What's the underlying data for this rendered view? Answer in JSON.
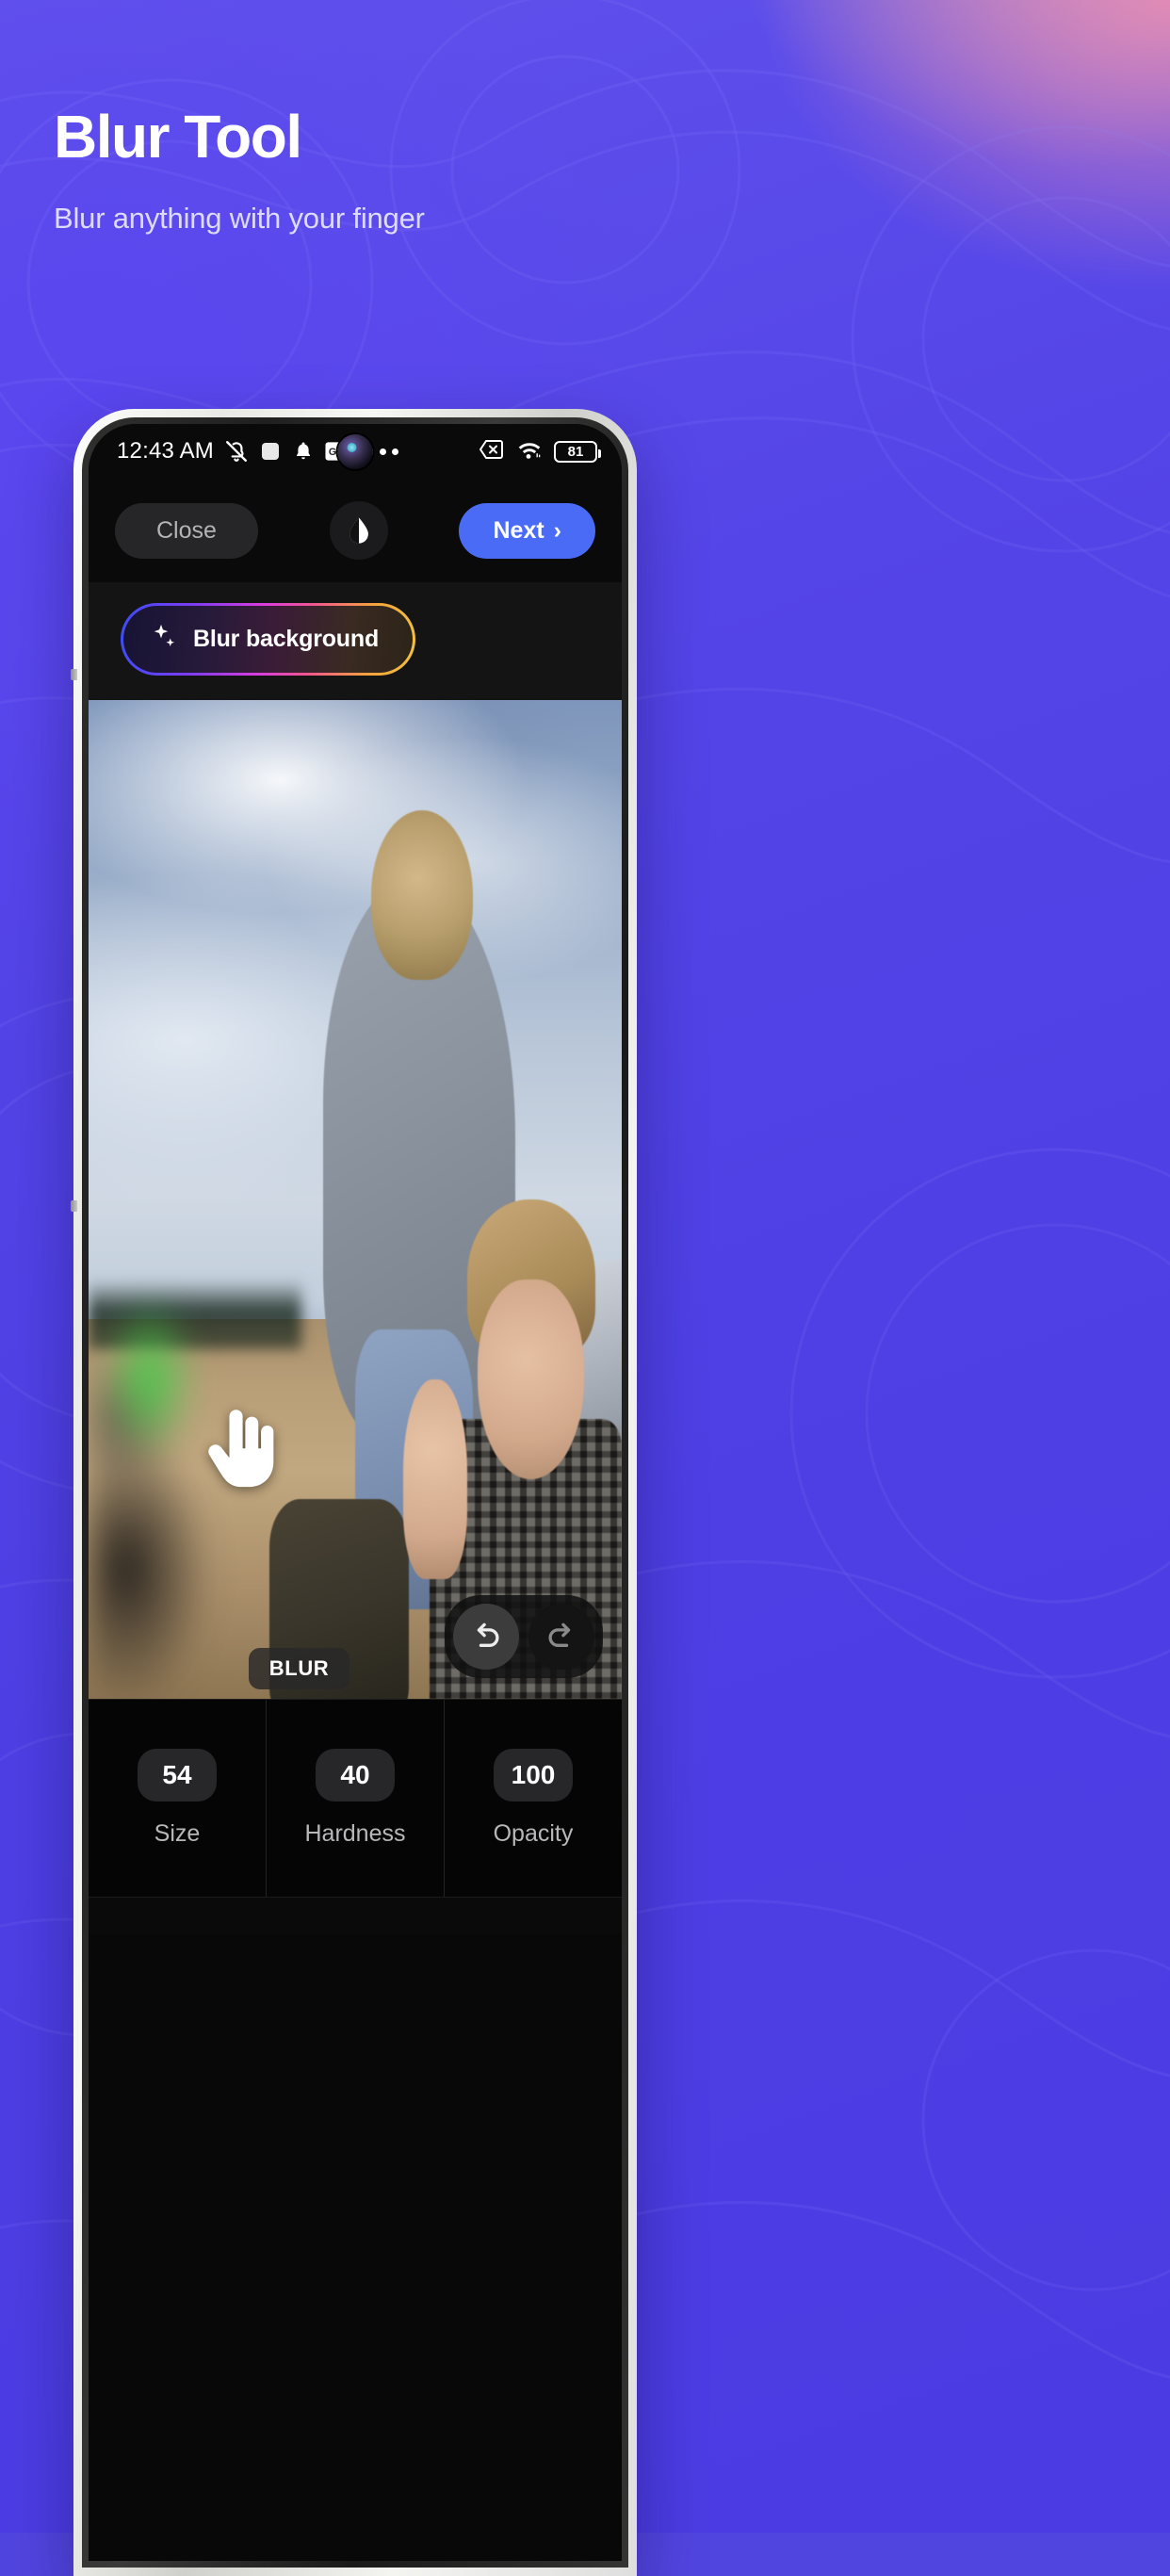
{
  "theme": {
    "bg_purple": "#5145e0",
    "accent_blue": "#4a6bf5",
    "panel_dark": "#0a0a0a",
    "pill_gray": "#262628"
  },
  "promo": {
    "headline": "Blur Tool",
    "subheadline": "Blur anything with your finger"
  },
  "phone": {
    "status_bar": {
      "clock": "12:43 AM",
      "left_icons": [
        "silent-mode-icon",
        "square-notification-icon",
        "bell-icon",
        "google-news-icon",
        "overflow-dots-icon"
      ],
      "right_icons": [
        "sim-disabled-icon",
        "wifi-icon"
      ],
      "battery_level": "81"
    },
    "toolbar": {
      "close_label": "Close",
      "tone_icon": "droplet-contrast-icon",
      "next_label": "Next",
      "next_chevron": "›"
    },
    "ai_bar": {
      "blur_background_label": "Blur background",
      "sparkle_icon": "sparkle-icon"
    },
    "canvas": {
      "mode_badge": "BLUR",
      "cursor_icon": "pointing-hand-icon",
      "undo_icon": "undo-arrow-icon",
      "redo_icon": "redo-arrow-icon"
    },
    "params": [
      {
        "value": "54",
        "label": "Size"
      },
      {
        "value": "40",
        "label": "Hardness"
      },
      {
        "value": "100",
        "label": "Opacity"
      }
    ]
  }
}
